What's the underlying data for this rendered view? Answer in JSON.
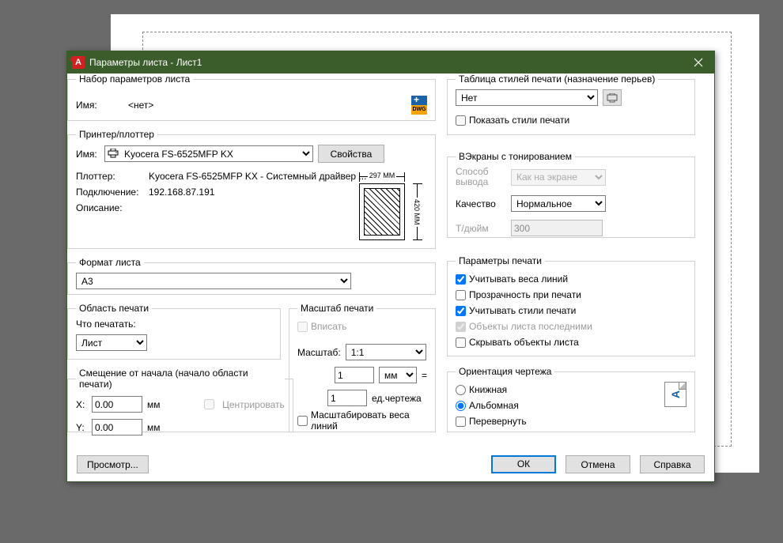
{
  "window": {
    "title": "Параметры листа - Лист1"
  },
  "pageSetup": {
    "legend": "Набор параметров листа",
    "nameLabel": "Имя:",
    "nameValue": "<нет>",
    "dwgLabel": "DWG"
  },
  "printer": {
    "legend": "Принтер/плоттер",
    "nameLabel": "Имя:",
    "nameValue": "Kyocera FS-6525MFP KX",
    "propsBtn": "Свойства",
    "plotterLabel": "Плоттер:",
    "plotterValue": "Kyocera FS-6525MFP KX - Системный драйвер ...",
    "connectLabel": "Подключение:",
    "connectValue": "192.168.87.191",
    "descLabel": "Описание:",
    "dimTop": "297 MM",
    "dimRight": "420 MM"
  },
  "paperSize": {
    "legend": "Формат листа",
    "value": "A3"
  },
  "plotArea": {
    "legend": "Область печати",
    "whatLabel": "Что печатать:",
    "value": "Лист"
  },
  "offset": {
    "legend": "Смещение от начала (начало области печати)",
    "xLabel": "X:",
    "xValue": "0.00",
    "yLabel": "Y:",
    "yValue": "0.00",
    "unit": "мм",
    "centerLabel": "Центрировать"
  },
  "scale": {
    "legend": "Масштаб печати",
    "fitLabel": "Вписать",
    "scaleLabel": "Масштаб:",
    "scaleValue": "1:1",
    "val1": "1",
    "unit1": "мм",
    "eq": "=",
    "val2": "1",
    "unit2": "ед.чертежа",
    "lwLabel": "Масштабировать веса линий"
  },
  "plotStyle": {
    "legend": "Таблица стилей печати (назначение перьев)",
    "value": "Нет",
    "showLabel": "Показать стили печати"
  },
  "shaded": {
    "legend": "ВЭкраны с тонированием",
    "modeLabel": "Способ вывода",
    "modeValue": "Как на экране",
    "qualityLabel": "Качество",
    "qualityValue": "Нормальное",
    "dpiLabel": "Т/дюйм",
    "dpiValue": "300"
  },
  "plotOpts": {
    "legend": "Параметры печати",
    "lw": "Учитывать веса линий",
    "transp": "Прозрачность при печати",
    "styles": "Учитывать стили печати",
    "last": "Объекты листа последними",
    "hide": "Скрывать объекты листа"
  },
  "orient": {
    "legend": "Ориентация чертежа",
    "portrait": "Книжная",
    "landscape": "Альбомная",
    "upside": "Перевернуть"
  },
  "footer": {
    "preview": "Просмотр...",
    "ok": "ОК",
    "cancel": "Отмена",
    "help": "Справка"
  }
}
